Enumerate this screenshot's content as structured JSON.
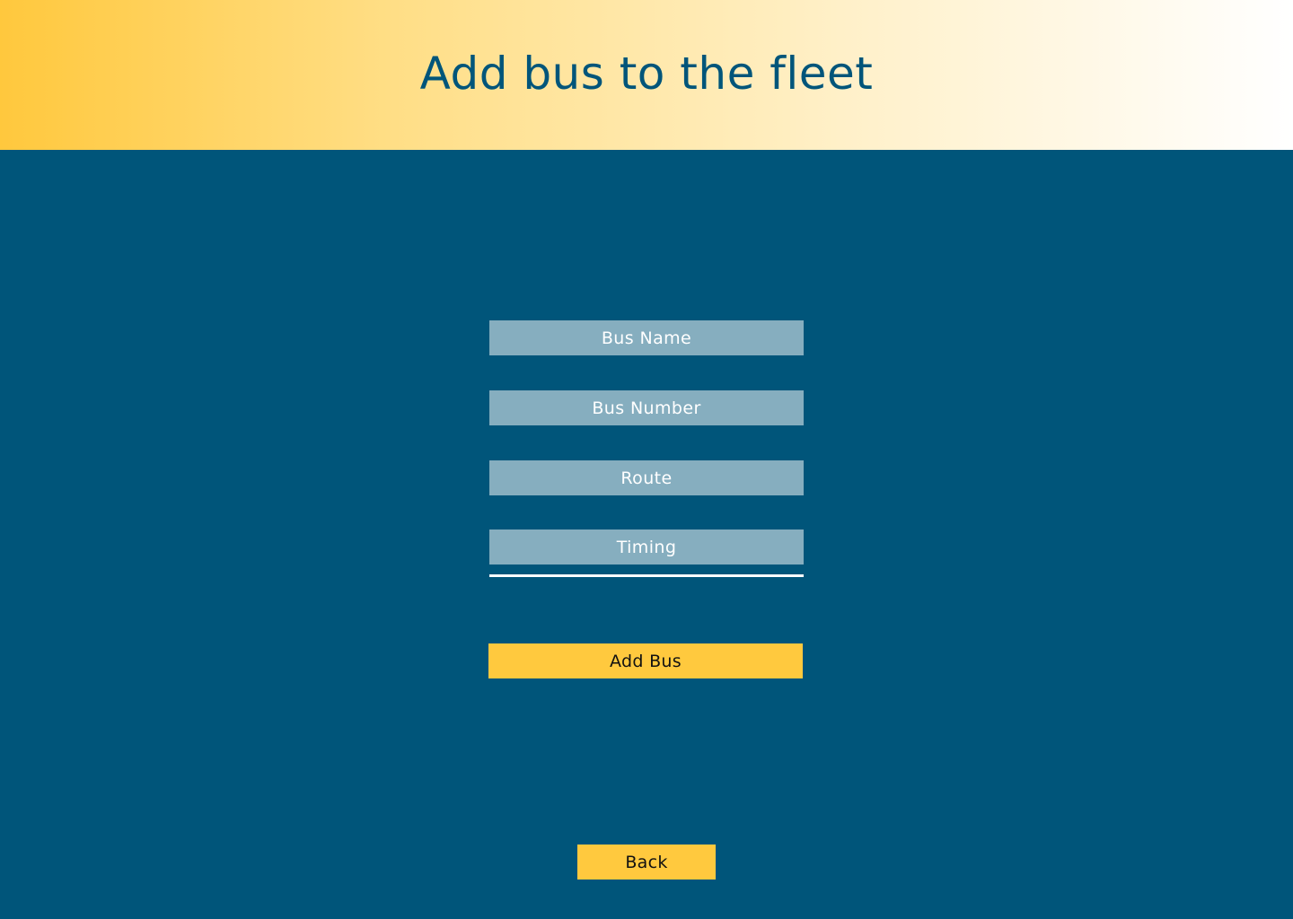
{
  "header": {
    "title": "Add bus to the fleet"
  },
  "form": {
    "bus_name_placeholder": "Bus Name",
    "bus_number_placeholder": "Bus Number",
    "route_placeholder": "Route",
    "timing_placeholder": "Timing",
    "add_button_label": "Add Bus"
  },
  "footer": {
    "back_button_label": "Back"
  },
  "colors": {
    "background": "#00557a",
    "header_gradient_start": "#ffc83d",
    "header_gradient_end": "#ffffff",
    "title_text": "#00557a",
    "field_background": "#86aebf",
    "field_text": "#ffffff",
    "button_background": "#ffc93e",
    "button_text": "#111111"
  }
}
